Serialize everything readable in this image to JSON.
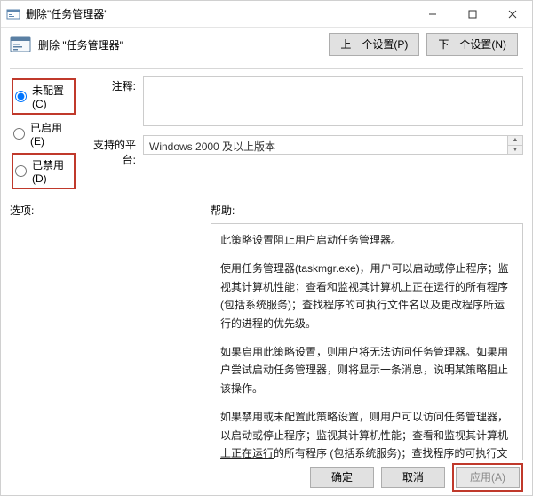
{
  "window": {
    "title": "删除\"任务管理器\"",
    "icon_name": "policy-icon"
  },
  "header": {
    "policy_title": "删除 \"任务管理器\"",
    "prev_btn": "上一个设置(P)",
    "next_btn": "下一个设置(N)"
  },
  "radios": {
    "not_configured": "未配置(C)",
    "enabled": "已启用(E)",
    "disabled": "已禁用(D)",
    "selected": "not_configured"
  },
  "fields": {
    "comment_label": "注释:",
    "comment_value": "",
    "platform_label": "支持的平台:",
    "platform_value": "Windows 2000 及以上版本"
  },
  "lower": {
    "options_label": "选项:",
    "help_label": "帮助:",
    "help": {
      "p1": "此策略设置阻止用户启动任务管理器。",
      "p2a": "使用任务管理器(taskmgr.exe)，用户可以启动或停止程序；监视其计算机性能；查看和监视其计算机",
      "p2b": "上正在运行",
      "p2c": "的所有程序(包括系统服务)；查找程序的可执行文件名以及更改程序所运行的进程的优先级。",
      "p3": "如果启用此策略设置，则用户将无法访问任务管理器。如果用户尝试启动任务管理器，则将显示一条消息，说明某策略阻止该操作。",
      "p4a": "如果禁用或未配置此策略设置，则用户可以访问任务管理器，以启动或停止程序；监视其计算机性能；查看和监视其计算机",
      "p4b": "上正在运行",
      "p4c": "的所有程序 (包括系统服务)；查找程序的可执行文件名以及更改程序所运行的进程的优先级。"
    }
  },
  "footer": {
    "ok": "确定",
    "cancel": "取消",
    "apply": "应用(A)"
  }
}
